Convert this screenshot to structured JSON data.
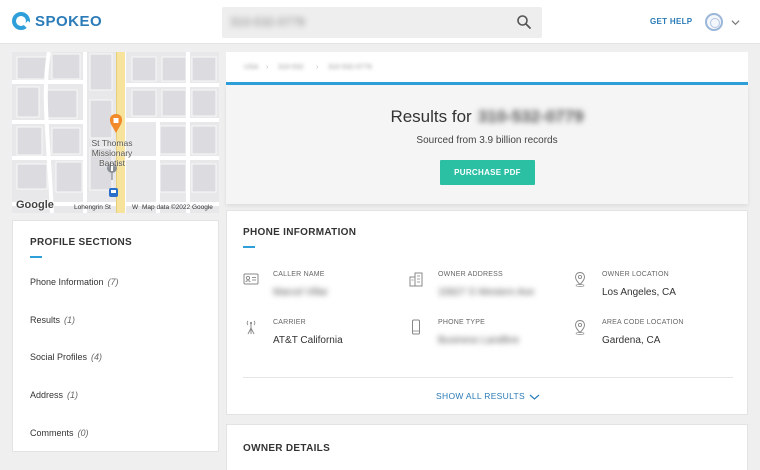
{
  "header": {
    "logo_text": "SPOKEO",
    "search_value": "310-532-0779",
    "get_help": "GET HELP"
  },
  "map": {
    "poi_name": "St Thomas Missionary Baptist",
    "street": "Lohengrin St",
    "street_abbrev": "W",
    "attribution": "Map data ©2022 Google",
    "google": "Google"
  },
  "profile_sections": {
    "title": "PROFILE SECTIONS",
    "items": [
      {
        "label": "Phone Information",
        "count": "(7)"
      },
      {
        "label": "Results",
        "count": "(1)"
      },
      {
        "label": "Social Profiles",
        "count": "(4)"
      },
      {
        "label": "Address",
        "count": "(1)"
      },
      {
        "label": "Comments",
        "count": "(0)"
      }
    ]
  },
  "breadcrumb": [
    "USA",
    "310-532",
    "310-532-0779"
  ],
  "results": {
    "prefix": "Results for",
    "number": "310-532-0779",
    "sourced": "Sourced from 3.9 billion records",
    "pdf_button": "PURCHASE PDF"
  },
  "phone_info": {
    "title": "PHONE INFORMATION",
    "fields": [
      {
        "label": "CALLER NAME",
        "value": "Marcel Villar",
        "icon": "id-card-icon",
        "blurred": true
      },
      {
        "label": "OWNER ADDRESS",
        "value": "15827 S Western Ave",
        "icon": "building-icon",
        "blurred": true
      },
      {
        "label": "OWNER LOCATION",
        "value": "Los Angeles, CA",
        "icon": "map-pin-icon",
        "blurred": false
      },
      {
        "label": "CARRIER",
        "value": "AT&T California",
        "icon": "antenna-icon",
        "blurred": false
      },
      {
        "label": "PHONE TYPE",
        "value": "Business Landline",
        "icon": "phone-icon",
        "blurred": true
      },
      {
        "label": "AREA CODE LOCATION",
        "value": "Gardena, CA",
        "icon": "map-pin-icon",
        "blurred": false
      }
    ],
    "show_all": "SHOW ALL RESULTS"
  },
  "owner_details": {
    "title": "OWNER DETAILS"
  },
  "colors": {
    "accent_blue": "#2e9fd9",
    "button_green": "#2bbfa4",
    "link_blue": "#2a7bb8"
  }
}
